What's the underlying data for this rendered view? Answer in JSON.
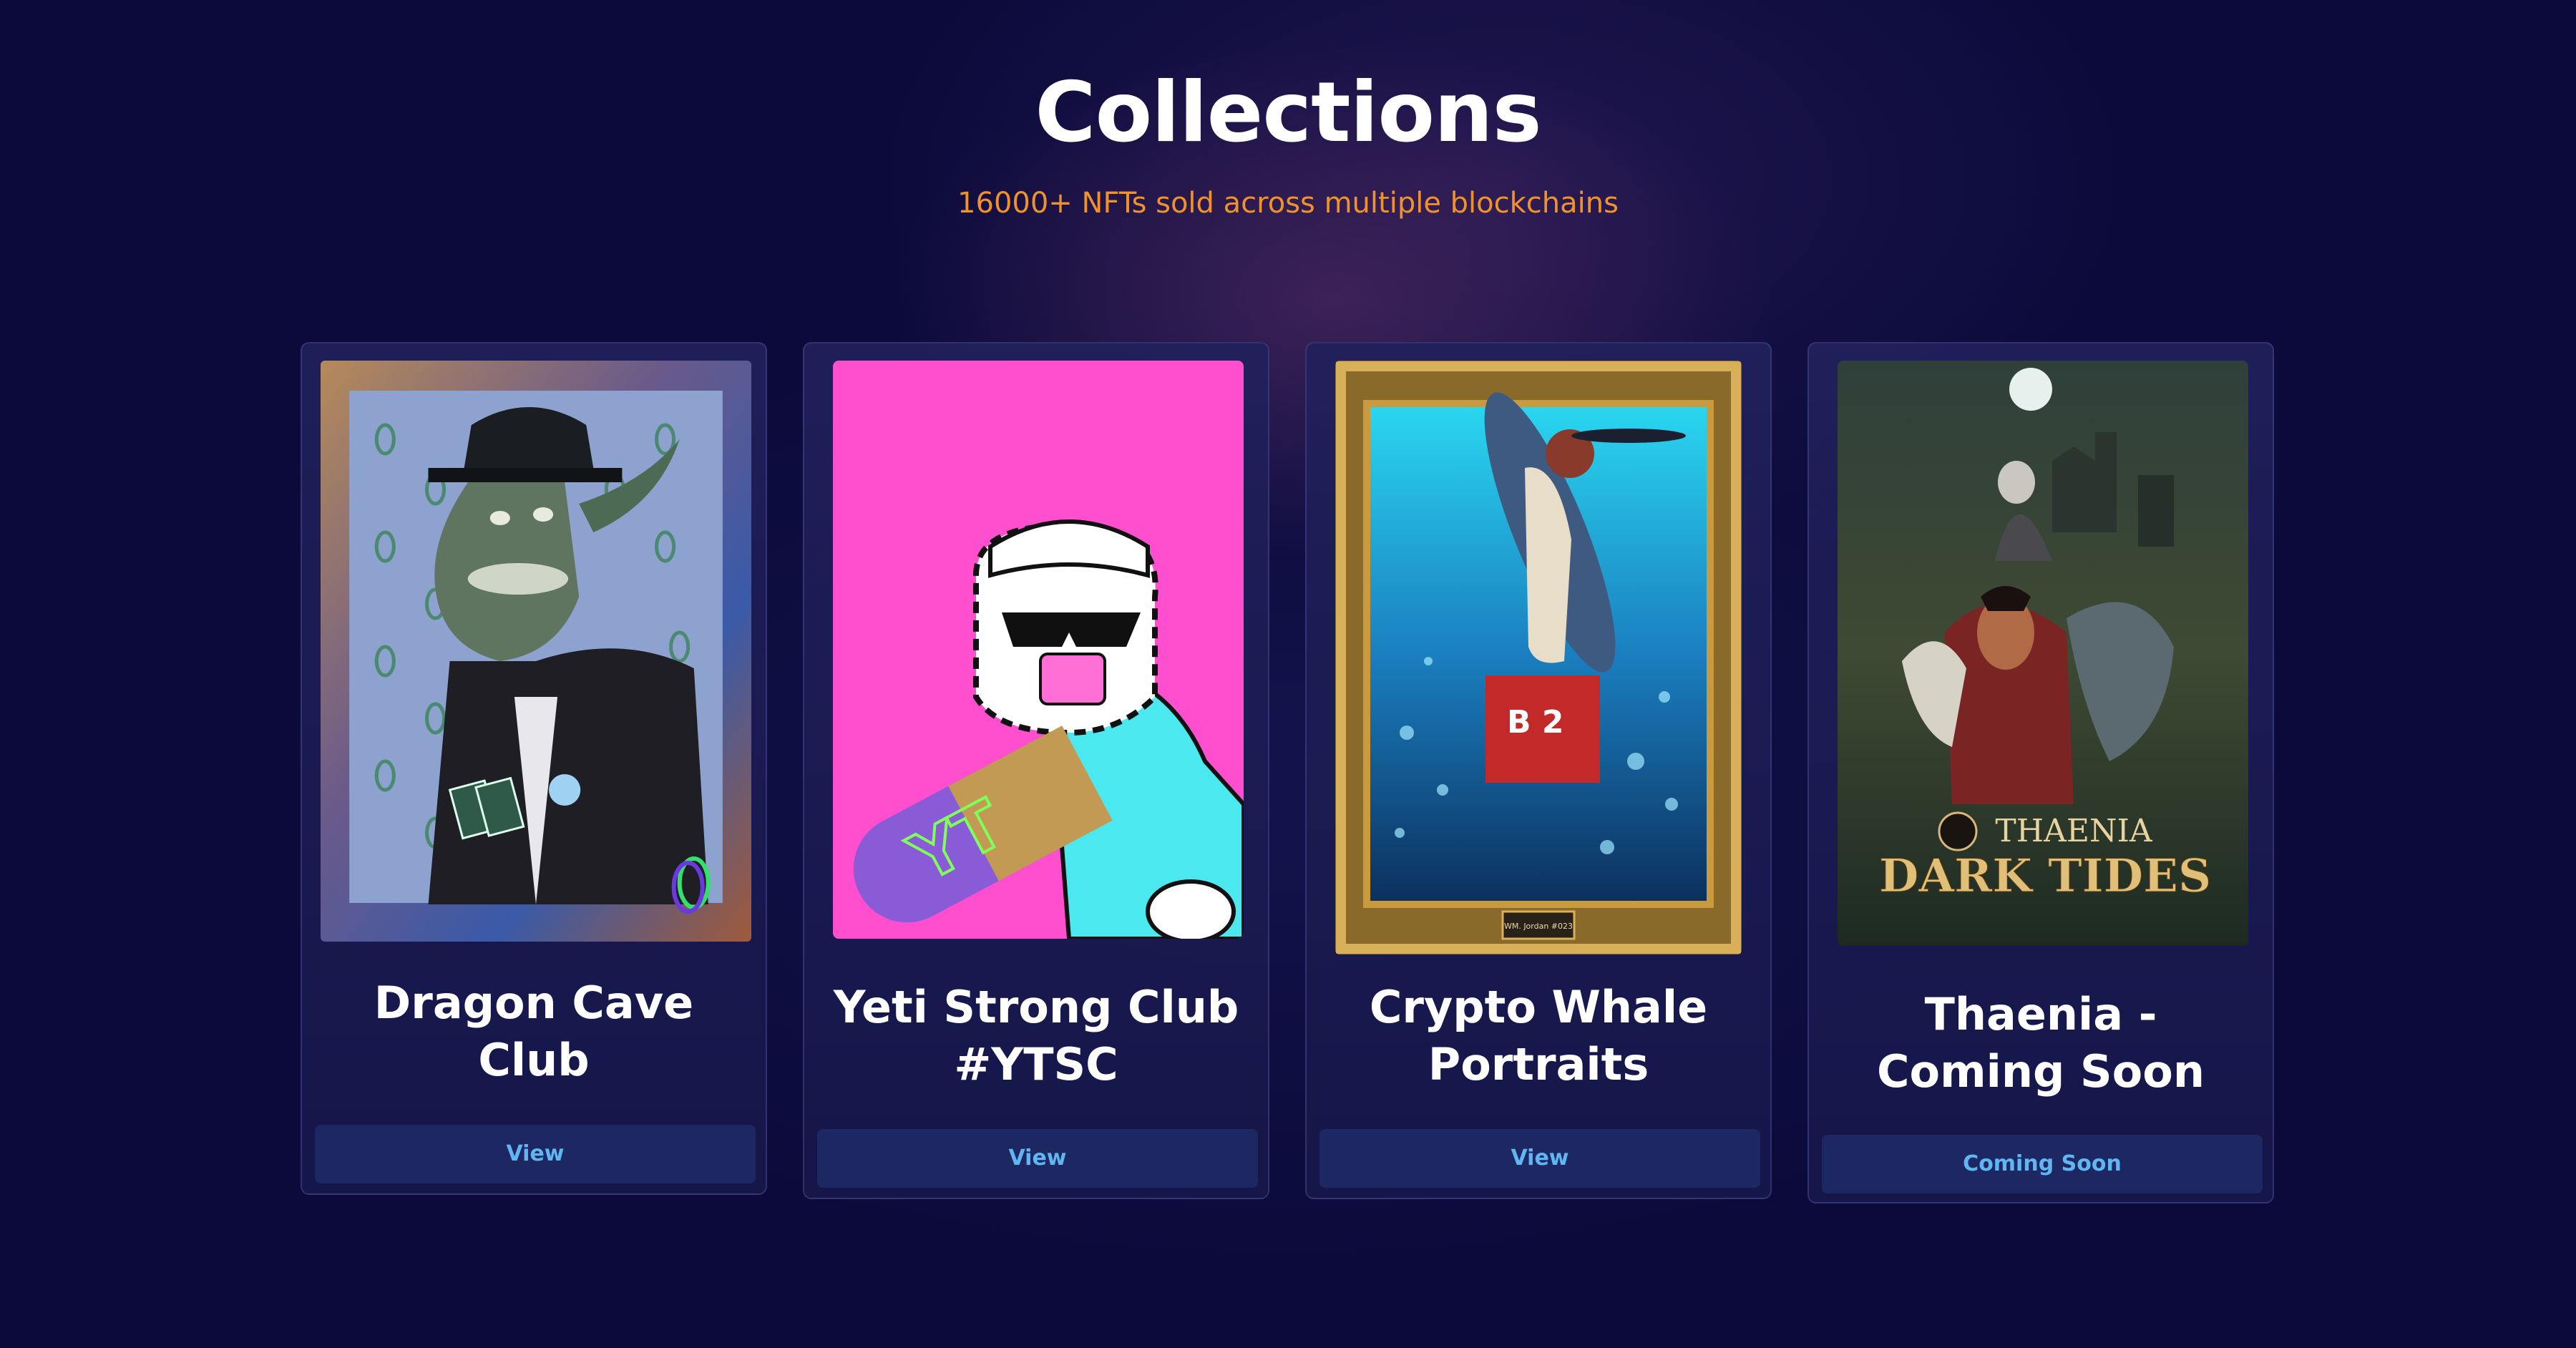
{
  "section": {
    "title": "Collections",
    "subtitle": "16000+ NFTs sold across multiple blockchains"
  },
  "cards": [
    {
      "title": "Dragon Cave\nClub",
      "button_label": "View",
      "image_icon": "dragon-nft-artwork"
    },
    {
      "title": "Yeti Strong Club\n#YTSC",
      "button_label": "View",
      "image_icon": "yeti-nft-artwork",
      "image_text": "YT"
    },
    {
      "title": "Crypto Whale\nPortraits",
      "button_label": "View",
      "image_icon": "whale-portrait-artwork",
      "image_text": "WM. Jordan #023"
    },
    {
      "title": "Thaenia -\nComing Soon",
      "button_label": "Coming Soon",
      "image_icon": "thaenia-game-artwork",
      "image_text_top": "THAENIA",
      "image_text_bottom": "DARK TIDES"
    }
  ],
  "colors": {
    "background": "#0b0a3a",
    "subtitle": "#f0922b",
    "button_bg": "#1d2863",
    "button_text": "#60b6f0"
  }
}
